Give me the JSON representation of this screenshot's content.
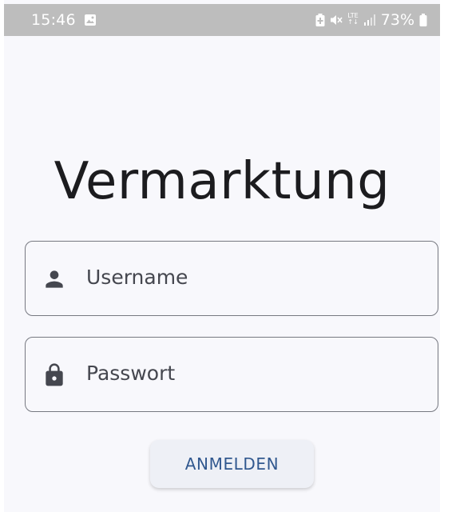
{
  "status_bar": {
    "time": "15:46",
    "network": "LTE",
    "battery": "73%",
    "icons": [
      "gallery-icon",
      "battery-saver-icon",
      "mute-icon",
      "lte-icon",
      "signal-icon",
      "battery-icon"
    ]
  },
  "title": "Vermarktung",
  "form": {
    "username": {
      "placeholder": "Username",
      "icon": "person-icon"
    },
    "password": {
      "placeholder": "Passwort",
      "icon": "lock-icon"
    },
    "submit_label": "ANMELDEN"
  },
  "colors": {
    "background": "#f8f8fc",
    "status_bar": "#bdbdbd",
    "field_border": "#777981",
    "button_background": "#eef0f6",
    "button_text": "#31588f"
  }
}
